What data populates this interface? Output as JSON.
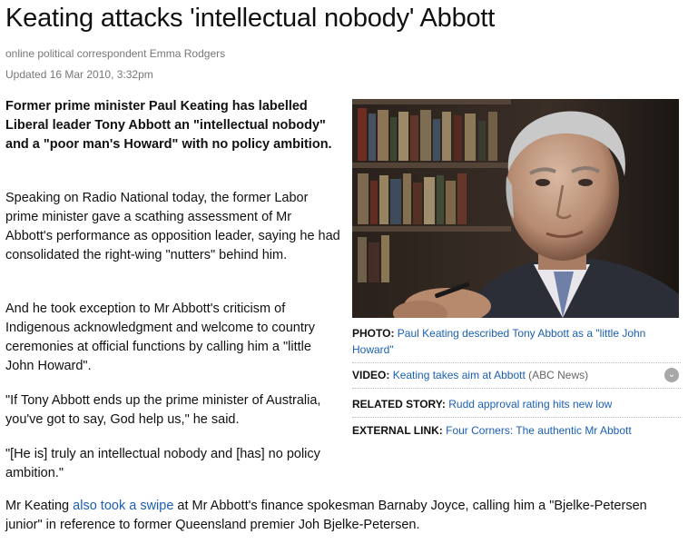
{
  "article": {
    "headline": "Keating attacks 'intellectual nobody' Abbott",
    "byline": "online political correspondent Emma Rodgers",
    "updated": "Updated 16 Mar 2010, 3:32pm",
    "lead": "Former prime minister Paul Keating has labelled Liberal leader Tony Abbott an \"intellectual nobody\" and a \"poor man's Howard\" with no policy ambition.",
    "paragraphs": [
      "Speaking on Radio National today, the former Labor prime minister gave a scathing assessment of Mr Abbott's performance as opposition leader, saying he had consolidated the right-wing \"nutters\" behind him.",
      "And he took exception to Mr Abbott's criticism of Indigenous acknowledgment and welcome to country ceremonies at official functions by calling him a \"little John Howard\".",
      "\"If Tony Abbott ends up the prime minister of Australia, you've got to say, God help us,\" he said.",
      "\"[He is] truly an intellectual nobody and [has] no policy ambition.\""
    ],
    "last_paragraph": {
      "before": "Mr Keating ",
      "link": "also took a swipe",
      "after": " at Mr Abbott's finance spokesman Barnaby Joyce, calling him a \"Bjelke-Petersen junior\" in reference to former Queensland premier Joh Bjelke-Petersen."
    }
  },
  "sidebar": {
    "photo": {
      "label": "PHOTO:",
      "caption": "Paul Keating described Tony Abbott as a \"little John Howard\""
    },
    "video": {
      "label": "VIDEO:",
      "link": "Keating takes aim at Abbott",
      "source": "(ABC News)",
      "icon": "chevron-down-icon"
    },
    "related": {
      "label": "RELATED STORY:",
      "link": "Rudd approval rating hits new low"
    },
    "external": {
      "label": "EXTERNAL LINK:",
      "link": "Four Corners: The authentic Mr Abbott"
    }
  },
  "colors": {
    "link": "#1a5fb4",
    "meta_text": "#777777",
    "body_text": "#111111"
  }
}
